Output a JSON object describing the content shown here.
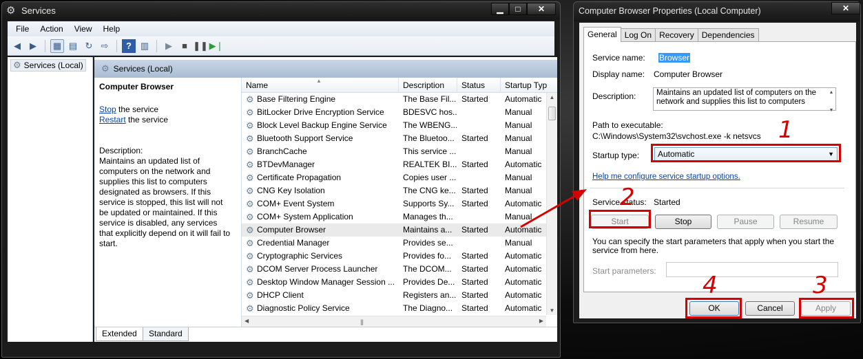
{
  "services_window": {
    "title": "Services",
    "caption_buttons": {
      "minimize": "▁",
      "maximize": "□",
      "close": "✕"
    },
    "menu": [
      "File",
      "Action",
      "View",
      "Help"
    ],
    "tree": {
      "root": "Services (Local)"
    },
    "header": "Services (Local)",
    "details": {
      "service_name": "Computer Browser",
      "stop_link": "Stop",
      "stop_suffix": " the service",
      "restart_link": "Restart",
      "restart_suffix": " the service",
      "description_label": "Description:",
      "description": "Maintains an updated list of computers on the network and supplies this list to computers designated as browsers. If this service is stopped, this list will not be updated or maintained. If this service is disabled, any services that explicitly depend on it will fail to start."
    },
    "columns": [
      "Name",
      "Description",
      "Status",
      "Startup Typ"
    ],
    "rows": [
      {
        "name": "Base Filtering Engine",
        "description": "The Base Fil...",
        "status": "Started",
        "startup": "Automatic"
      },
      {
        "name": "BitLocker Drive Encryption Service",
        "description": "BDESVC hos...",
        "status": "",
        "startup": "Manual"
      },
      {
        "name": "Block Level Backup Engine Service",
        "description": "The WBENG...",
        "status": "",
        "startup": "Manual"
      },
      {
        "name": "Bluetooth Support Service",
        "description": "The Bluetoo...",
        "status": "Started",
        "startup": "Manual"
      },
      {
        "name": "BranchCache",
        "description": "This service ...",
        "status": "",
        "startup": "Manual"
      },
      {
        "name": "BTDevManager",
        "description": "REALTEK BI...",
        "status": "Started",
        "startup": "Automatic"
      },
      {
        "name": "Certificate Propagation",
        "description": "Copies user ...",
        "status": "",
        "startup": "Manual"
      },
      {
        "name": "CNG Key Isolation",
        "description": "The CNG ke...",
        "status": "Started",
        "startup": "Manual"
      },
      {
        "name": "COM+ Event System",
        "description": "Supports Sy...",
        "status": "Started",
        "startup": "Automatic"
      },
      {
        "name": "COM+ System Application",
        "description": "Manages th...",
        "status": "",
        "startup": "Manual"
      },
      {
        "name": "Computer Browser",
        "description": "Maintains a...",
        "status": "Started",
        "startup": "Automatic"
      },
      {
        "name": "Credential Manager",
        "description": "Provides se...",
        "status": "",
        "startup": "Manual"
      },
      {
        "name": "Cryptographic Services",
        "description": "Provides fo...",
        "status": "Started",
        "startup": "Automatic"
      },
      {
        "name": "DCOM Server Process Launcher",
        "description": "The DCOM...",
        "status": "Started",
        "startup": "Automatic"
      },
      {
        "name": "Desktop Window Manager Session ...",
        "description": "Provides De...",
        "status": "Started",
        "startup": "Automatic"
      },
      {
        "name": "DHCP Client",
        "description": "Registers an...",
        "status": "Started",
        "startup": "Automatic"
      },
      {
        "name": "Diagnostic Policy Service",
        "description": "The Diagno...",
        "status": "Started",
        "startup": "Automatic"
      }
    ],
    "selected_row": 10,
    "bottom_tabs": [
      "Extended",
      "Standard"
    ]
  },
  "properties_dialog": {
    "title": "Computer Browser Properties (Local Computer)",
    "close": "✕",
    "tabs": [
      "General",
      "Log On",
      "Recovery",
      "Dependencies"
    ],
    "service_name_label": "Service name:",
    "service_name": "Browser",
    "display_name_label": "Display name:",
    "display_name": "Computer Browser",
    "description_label": "Description:",
    "description": "Maintains an updated list of computers on the network and supplies this list to computers",
    "path_label": "Path to executable:",
    "path": "C:\\Windows\\System32\\svchost.exe -k netsvcs",
    "startup_type_label": "Startup type:",
    "startup_type": "Automatic",
    "help_link": "Help me configure service startup options.",
    "status_label": "Service status:",
    "status": "Started",
    "buttons": {
      "start": "Start",
      "stop": "Stop",
      "pause": "Pause",
      "resume": "Resume"
    },
    "params_note": "You can specify the start parameters that apply when you start the service from here.",
    "start_params_label": "Start parameters:",
    "footer": {
      "ok": "OK",
      "cancel": "Cancel",
      "apply": "Apply"
    }
  },
  "annotations": [
    "1",
    "2",
    "3",
    "4"
  ],
  "colors": {
    "annotation": "#d60000",
    "selection": "#3399ff",
    "link": "#0645ad"
  }
}
